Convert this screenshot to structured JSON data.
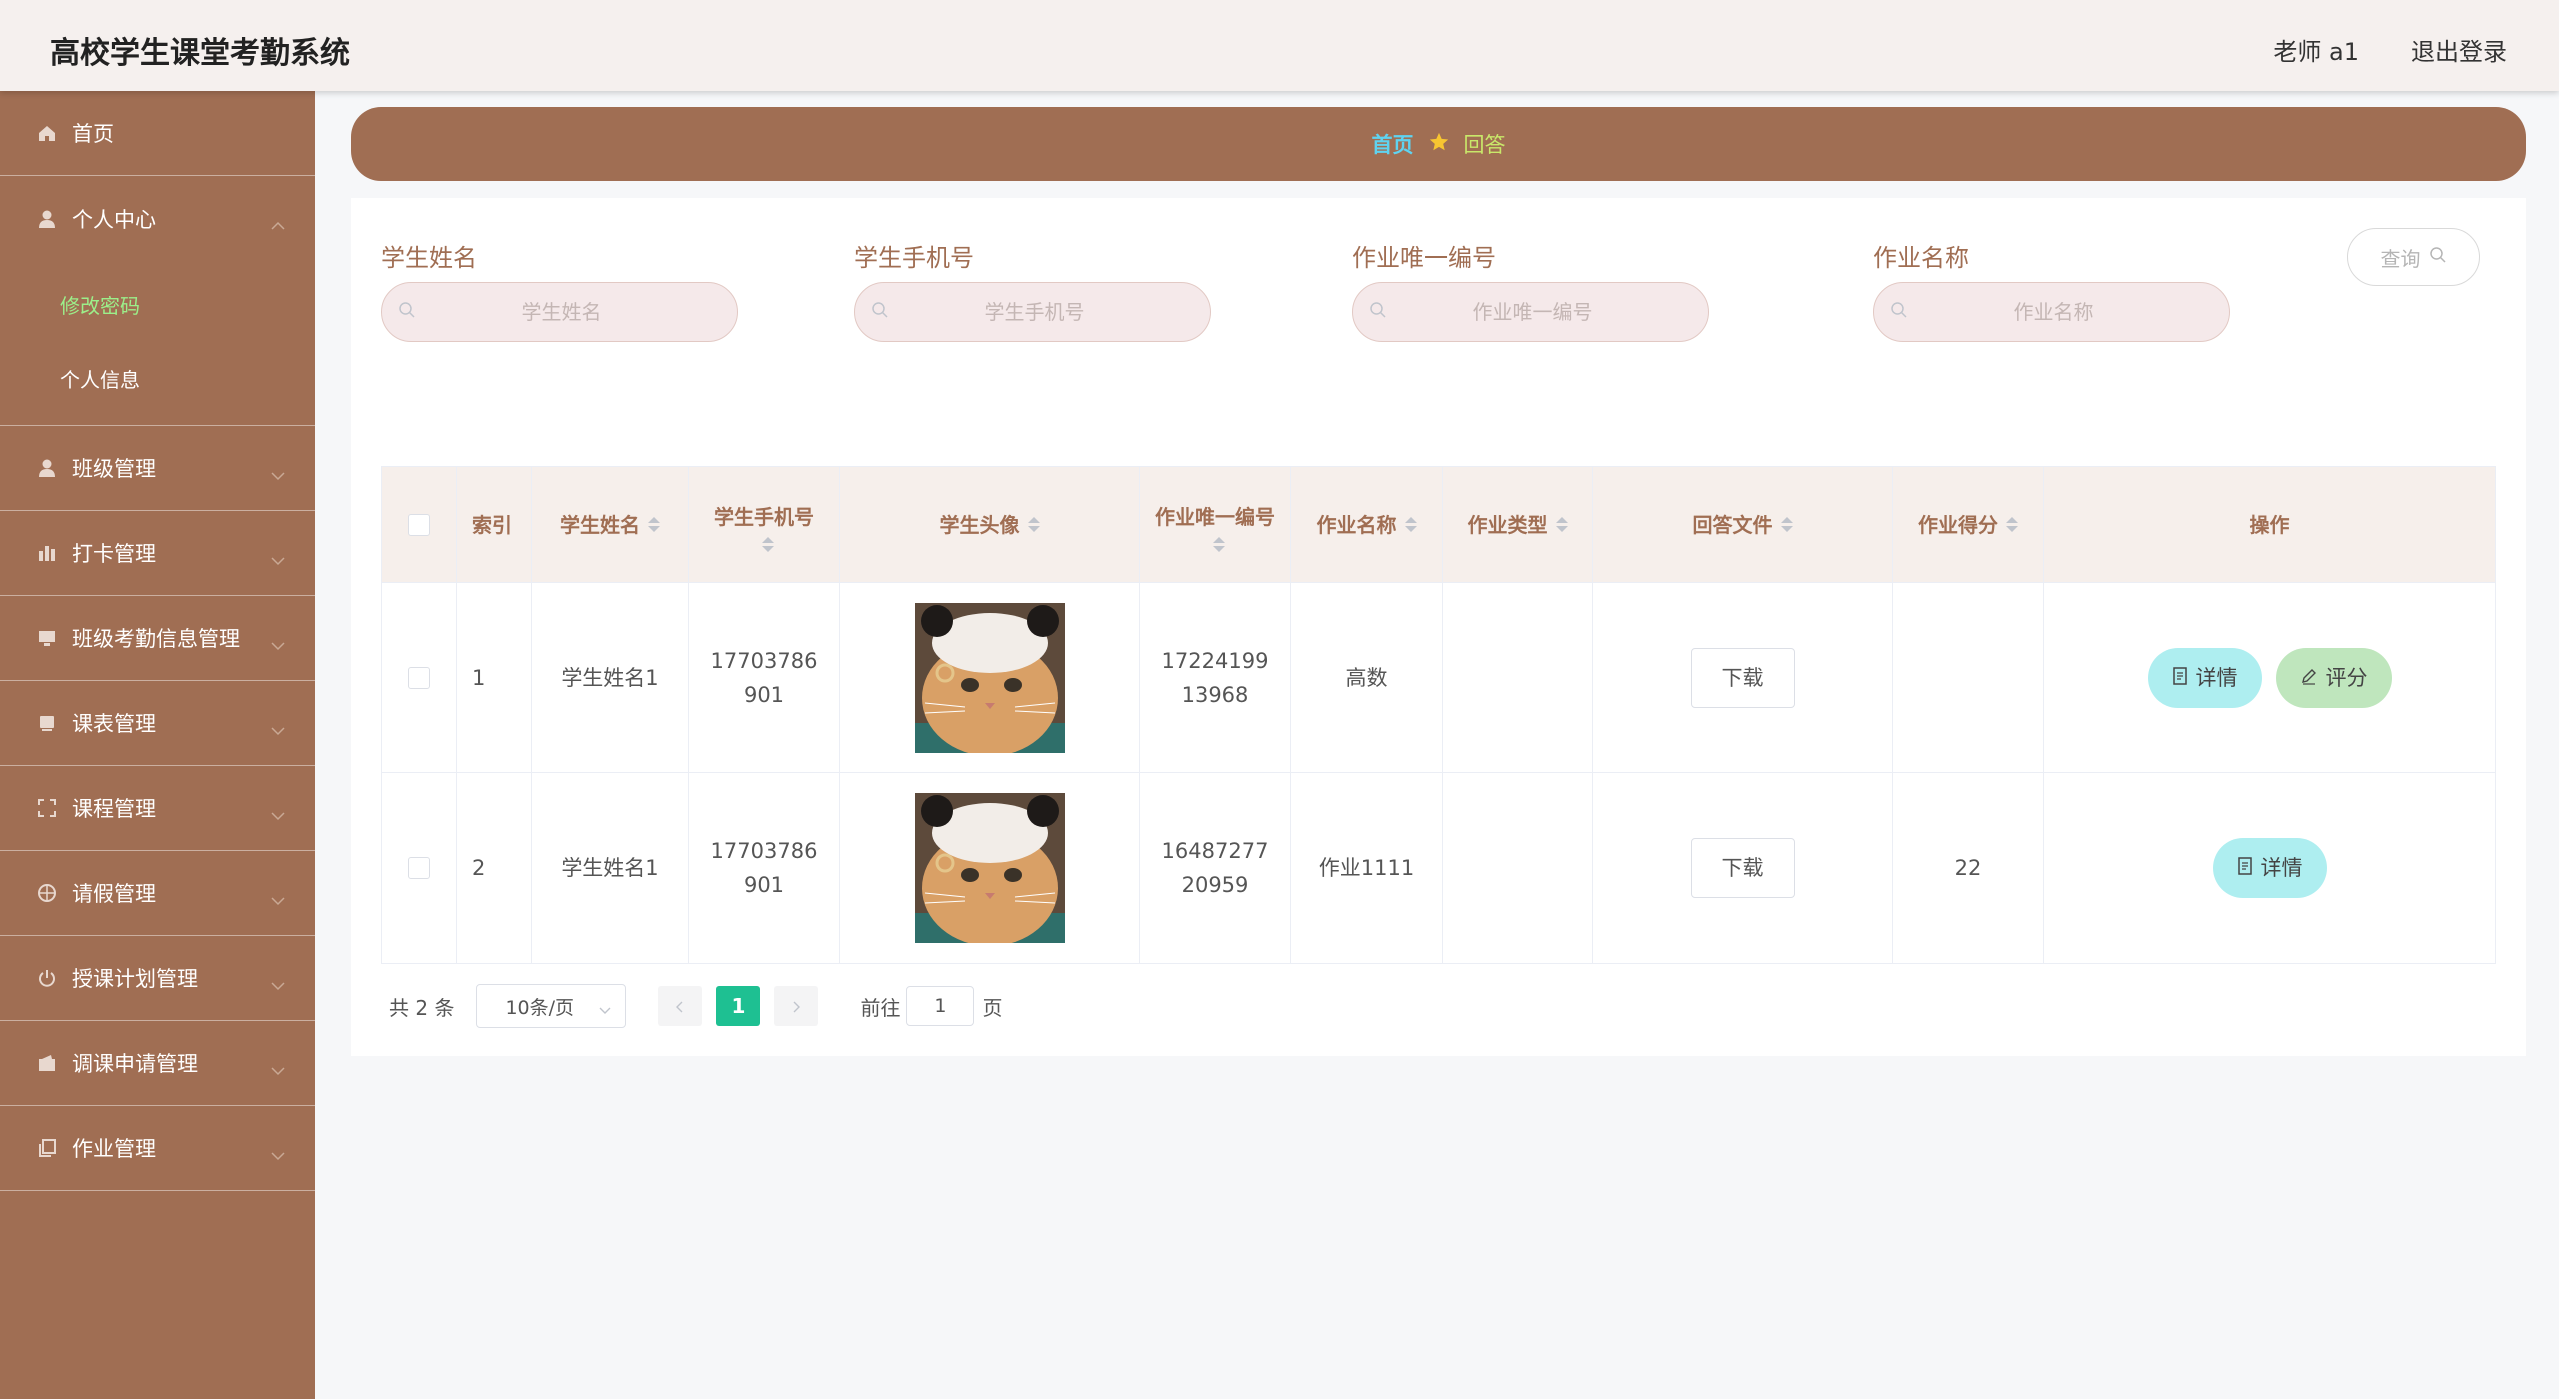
{
  "header": {
    "title": "高校学生课堂考勤系统",
    "user": "老师 a1",
    "logout": "退出登录"
  },
  "sidebar": {
    "items": [
      {
        "label": "首页",
        "icon": "home-icon"
      },
      {
        "label": "个人中心",
        "icon": "user-icon"
      },
      {
        "label": "班级管理",
        "icon": "user-icon"
      },
      {
        "label": "打卡管理",
        "icon": "chart-icon"
      },
      {
        "label": "班级考勤信息管理",
        "icon": "monitor-icon"
      },
      {
        "label": "课表管理",
        "icon": "book-icon"
      },
      {
        "label": "课程管理",
        "icon": "frame-icon"
      },
      {
        "label": "请假管理",
        "icon": "compass-icon"
      },
      {
        "label": "授课计划管理",
        "icon": "power-icon"
      },
      {
        "label": "调课申请管理",
        "icon": "wallet-icon"
      },
      {
        "label": "作业管理",
        "icon": "copy-icon"
      }
    ],
    "sub_items": [
      {
        "label": "修改密码",
        "active": true
      },
      {
        "label": "个人信息",
        "active": false
      }
    ]
  },
  "breadcrumb": {
    "home": "首页",
    "current": "回答"
  },
  "filters": [
    {
      "label": "学生姓名",
      "placeholder": "学生姓名",
      "value": ""
    },
    {
      "label": "学生手机号",
      "placeholder": "学生手机号",
      "value": ""
    },
    {
      "label": "作业唯一编号",
      "placeholder": "作业唯一编号",
      "value": ""
    },
    {
      "label": "作业名称",
      "placeholder": "作业名称",
      "value": ""
    }
  ],
  "query_button": "查询",
  "table": {
    "headers": [
      "索引",
      "学生姓名",
      "学生手机号",
      "学生头像",
      "作业唯一编号",
      "作业名称",
      "作业类型",
      "回答文件",
      "作业得分",
      "操作"
    ],
    "rows": [
      {
        "index": "1",
        "name": "学生姓名1",
        "phone": "17703786901",
        "hw_id": "1722419913968",
        "hw_name": "高数",
        "hw_type": "",
        "file_btn": "下载",
        "score": "",
        "actions": [
          "详情",
          "评分"
        ]
      },
      {
        "index": "2",
        "name": "学生姓名1",
        "phone": "17703786901",
        "hw_id": "1648727720959",
        "hw_name": "作业1111",
        "hw_type": "",
        "file_btn": "下载",
        "score": "22",
        "actions": [
          "详情"
        ]
      }
    ]
  },
  "pagination": {
    "total": "共 2 条",
    "page_size": "10条/页",
    "current_page": "1",
    "goto_label": "前往",
    "goto_value": "1",
    "page_unit": "页"
  },
  "colors": {
    "brand": "#a06e53",
    "active_green": "#9cef8a",
    "page_active": "#1ec092",
    "detail_btn": "#aeeef0",
    "score_btn": "#bfe6bd"
  }
}
